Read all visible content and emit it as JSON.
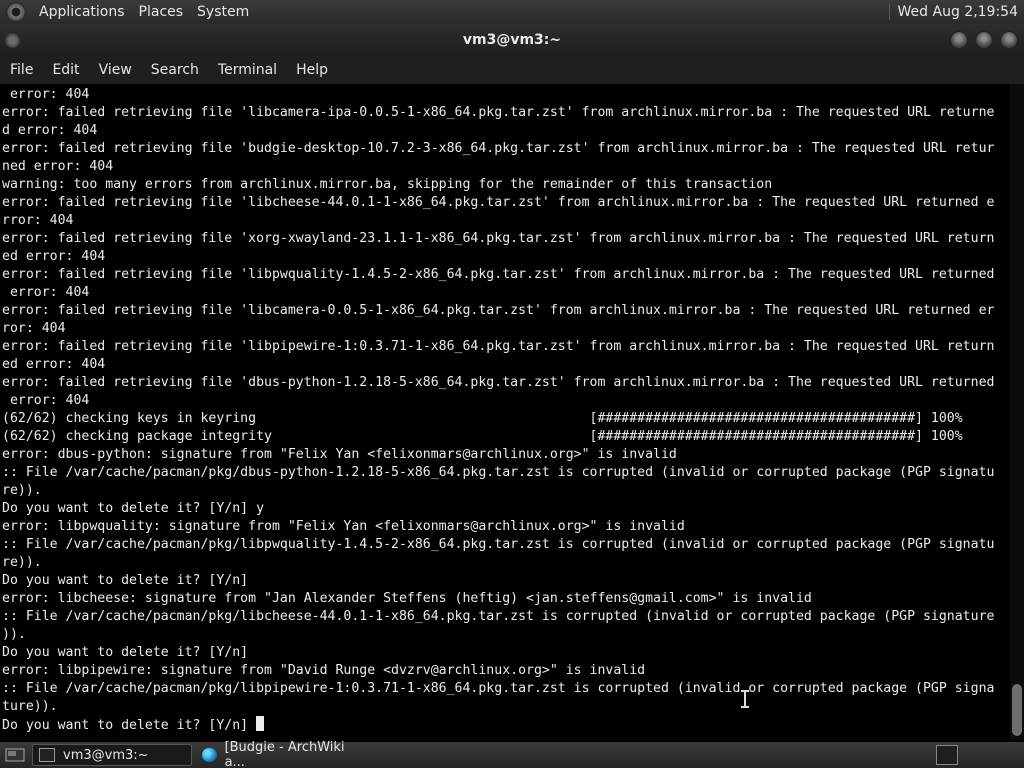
{
  "top_panel": {
    "menus": [
      "Applications",
      "Places",
      "System"
    ],
    "clock": "Wed Aug  2,19:54"
  },
  "window": {
    "title": "vm3@vm3:~"
  },
  "menubar": [
    "File",
    "Edit",
    "View",
    "Search",
    "Terminal",
    "Help"
  ],
  "terminal": {
    "lines": [
      " error: 404",
      "error: failed retrieving file 'libcamera-ipa-0.0.5-1-x86_64.pkg.tar.zst' from archlinux.mirror.ba : The requested URL returne",
      "d error: 404",
      "error: failed retrieving file 'budgie-desktop-10.7.2-3-x86_64.pkg.tar.zst' from archlinux.mirror.ba : The requested URL retur",
      "ned error: 404",
      "warning: too many errors from archlinux.mirror.ba, skipping for the remainder of this transaction",
      "error: failed retrieving file 'libcheese-44.0.1-1-x86_64.pkg.tar.zst' from archlinux.mirror.ba : The requested URL returned e",
      "rror: 404",
      "error: failed retrieving file 'xorg-xwayland-23.1.1-1-x86_64.pkg.tar.zst' from archlinux.mirror.ba : The requested URL return",
      "ed error: 404",
      "error: failed retrieving file 'libpwquality-1.4.5-2-x86_64.pkg.tar.zst' from archlinux.mirror.ba : The requested URL returned",
      " error: 404",
      "error: failed retrieving file 'libcamera-0.0.5-1-x86_64.pkg.tar.zst' from archlinux.mirror.ba : The requested URL returned er",
      "ror: 404",
      "error: failed retrieving file 'libpipewire-1:0.3.71-1-x86_64.pkg.tar.zst' from archlinux.mirror.ba : The requested URL return",
      "ed error: 404",
      "error: failed retrieving file 'dbus-python-1.2.18-5-x86_64.pkg.tar.zst' from archlinux.mirror.ba : The requested URL returned",
      " error: 404",
      "(62/62) checking keys in keyring                                          [########################################] 100%",
      "(62/62) checking package integrity                                        [########################################] 100%",
      "error: dbus-python: signature from \"Felix Yan <felixonmars@archlinux.org>\" is invalid",
      ":: File /var/cache/pacman/pkg/dbus-python-1.2.18-5-x86_64.pkg.tar.zst is corrupted (invalid or corrupted package (PGP signatu",
      "re)).",
      "Do you want to delete it? [Y/n] y",
      "error: libpwquality: signature from \"Felix Yan <felixonmars@archlinux.org>\" is invalid",
      ":: File /var/cache/pacman/pkg/libpwquality-1.4.5-2-x86_64.pkg.tar.zst is corrupted (invalid or corrupted package (PGP signatu",
      "re)).",
      "Do you want to delete it? [Y/n]",
      "error: libcheese: signature from \"Jan Alexander Steffens (heftig) <jan.steffens@gmail.com>\" is invalid",
      ":: File /var/cache/pacman/pkg/libcheese-44.0.1-1-x86_64.pkg.tar.zst is corrupted (invalid or corrupted package (PGP signature",
      ")).",
      "Do you want to delete it? [Y/n]",
      "error: libpipewire: signature from \"David Runge <dvzrv@archlinux.org>\" is invalid",
      ":: File /var/cache/pacman/pkg/libpipewire-1:0.3.71-1-x86_64.pkg.tar.zst is corrupted (invalid or corrupted package (PGP signa",
      "ture))."
    ],
    "prompt": "Do you want to delete it? [Y/n] "
  },
  "taskbar": {
    "tasks": [
      "vm3@vm3:~",
      "[Budgie - ArchWiki a..."
    ]
  },
  "icons": {
    "logo": "gnome-foot-icon",
    "terminal": "terminal-icon",
    "browser": "edge-browser-icon"
  }
}
